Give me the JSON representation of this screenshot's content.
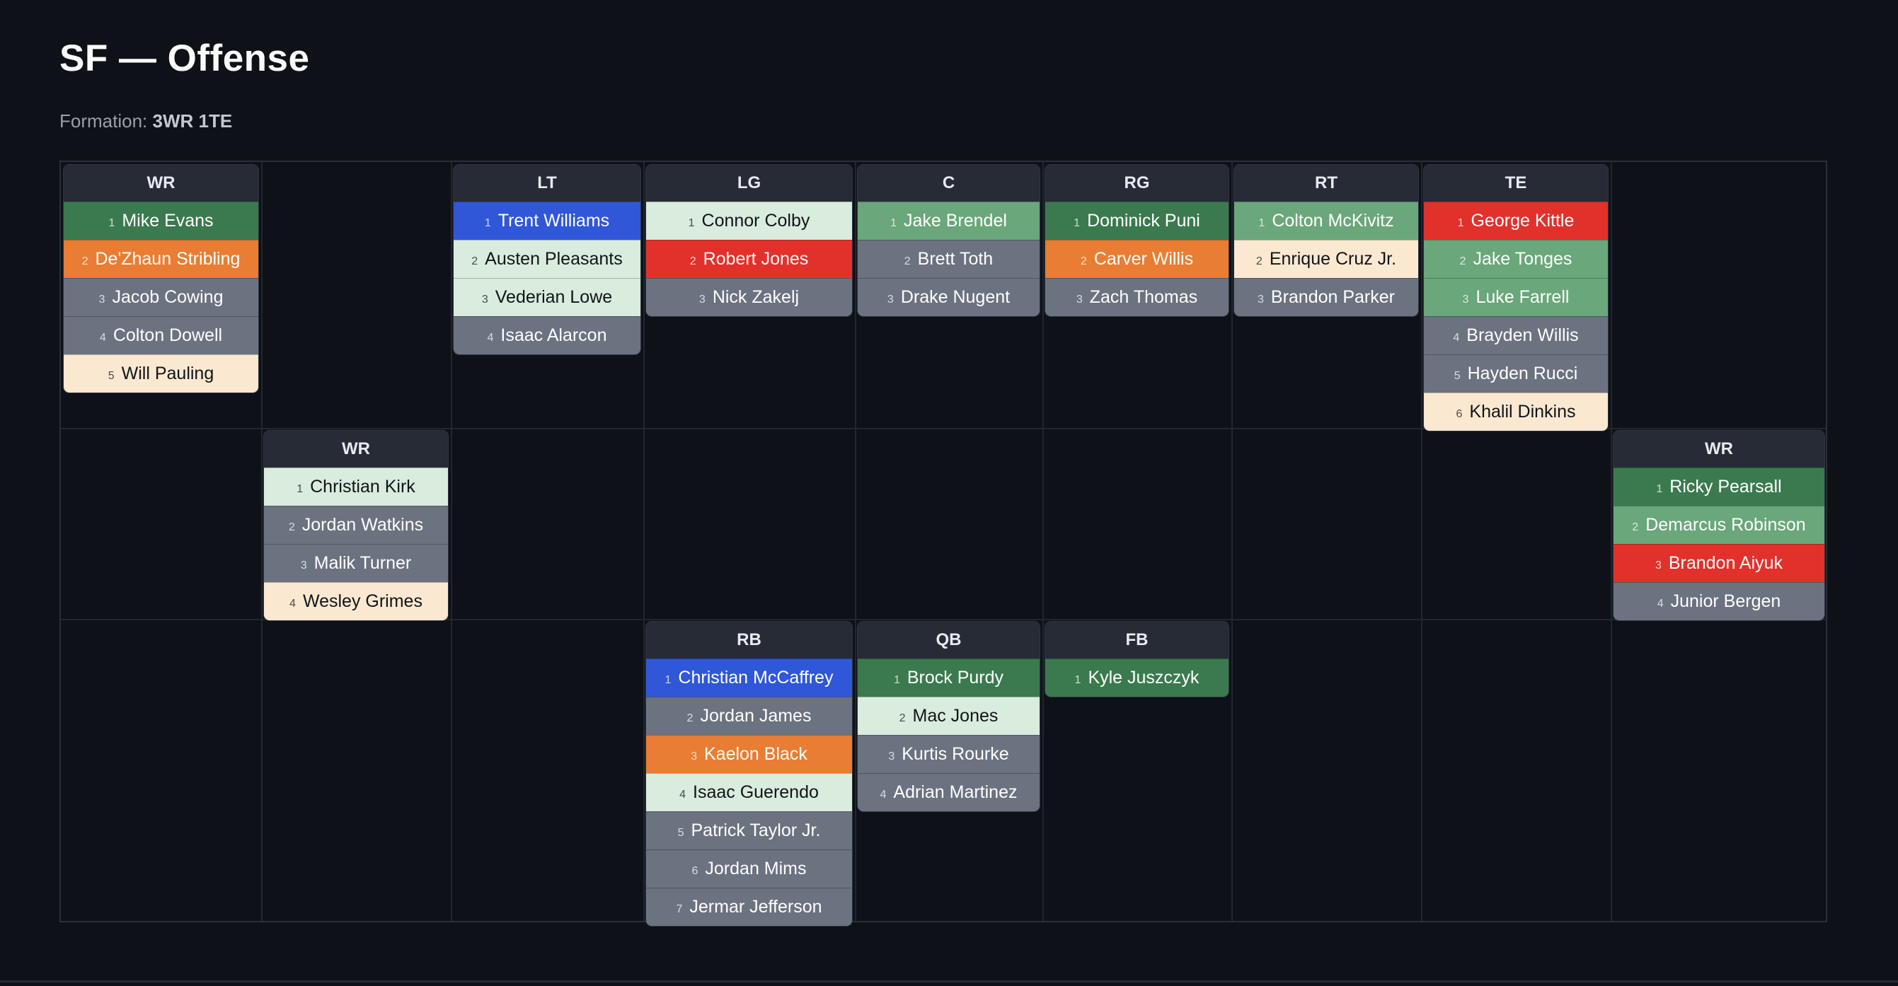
{
  "page": {
    "title": "SF — Offense",
    "formation_label": "Formation:",
    "formation_value": "3WR 1TE"
  },
  "colors": {
    "dark_green": "#3b7a4e",
    "mid_green": "#6aa77a",
    "light_green": "#d9ecdd",
    "orange": "#e97d33",
    "red": "#e2312b",
    "blue": "#2f57d8",
    "gray": "#6b7280",
    "cream": "#fbe8d1"
  },
  "positions": [
    {
      "key": "wr1",
      "label": "WR",
      "players": [
        {
          "n": "1",
          "name": "Mike Evans",
          "color": "dark_green"
        },
        {
          "n": "2",
          "name": "De'Zhaun Stribling",
          "color": "orange"
        },
        {
          "n": "3",
          "name": "Jacob Cowing",
          "color": "gray"
        },
        {
          "n": "4",
          "name": "Colton Dowell",
          "color": "gray"
        },
        {
          "n": "5",
          "name": "Will Pauling",
          "color": "cream"
        }
      ]
    },
    {
      "key": "lt",
      "label": "LT",
      "players": [
        {
          "n": "1",
          "name": "Trent Williams",
          "color": "blue"
        },
        {
          "n": "2",
          "name": "Austen Pleasants",
          "color": "light_green"
        },
        {
          "n": "3",
          "name": "Vederian Lowe",
          "color": "light_green"
        },
        {
          "n": "4",
          "name": "Isaac Alarcon",
          "color": "gray"
        }
      ]
    },
    {
      "key": "lg",
      "label": "LG",
      "players": [
        {
          "n": "1",
          "name": "Connor Colby",
          "color": "light_green"
        },
        {
          "n": "2",
          "name": "Robert Jones",
          "color": "red"
        },
        {
          "n": "3",
          "name": "Nick Zakelj",
          "color": "gray"
        }
      ]
    },
    {
      "key": "c",
      "label": "C",
      "players": [
        {
          "n": "1",
          "name": "Jake Brendel",
          "color": "mid_green"
        },
        {
          "n": "2",
          "name": "Brett Toth",
          "color": "gray"
        },
        {
          "n": "3",
          "name": "Drake Nugent",
          "color": "gray"
        }
      ]
    },
    {
      "key": "rg",
      "label": "RG",
      "players": [
        {
          "n": "1",
          "name": "Dominick Puni",
          "color": "dark_green"
        },
        {
          "n": "2",
          "name": "Carver Willis",
          "color": "orange"
        },
        {
          "n": "3",
          "name": "Zach Thomas",
          "color": "gray"
        }
      ]
    },
    {
      "key": "rt",
      "label": "RT",
      "players": [
        {
          "n": "1",
          "name": "Colton McKivitz",
          "color": "mid_green"
        },
        {
          "n": "2",
          "name": "Enrique Cruz Jr.",
          "color": "cream"
        },
        {
          "n": "3",
          "name": "Brandon Parker",
          "color": "gray"
        }
      ]
    },
    {
      "key": "te",
      "label": "TE",
      "players": [
        {
          "n": "1",
          "name": "George Kittle",
          "color": "red"
        },
        {
          "n": "2",
          "name": "Jake Tonges",
          "color": "mid_green"
        },
        {
          "n": "3",
          "name": "Luke Farrell",
          "color": "mid_green"
        },
        {
          "n": "4",
          "name": "Brayden Willis",
          "color": "gray"
        },
        {
          "n": "5",
          "name": "Hayden Rucci",
          "color": "gray"
        },
        {
          "n": "6",
          "name": "Khalil Dinkins",
          "color": "cream"
        }
      ]
    },
    {
      "key": "wr2",
      "label": "WR",
      "players": [
        {
          "n": "1",
          "name": "Christian Kirk",
          "color": "light_green"
        },
        {
          "n": "2",
          "name": "Jordan Watkins",
          "color": "gray"
        },
        {
          "n": "3",
          "name": "Malik Turner",
          "color": "gray"
        },
        {
          "n": "4",
          "name": "Wesley Grimes",
          "color": "cream"
        }
      ]
    },
    {
      "key": "wr3",
      "label": "WR",
      "players": [
        {
          "n": "1",
          "name": "Ricky Pearsall",
          "color": "dark_green"
        },
        {
          "n": "2",
          "name": "Demarcus Robinson",
          "color": "mid_green"
        },
        {
          "n": "3",
          "name": "Brandon Aiyuk",
          "color": "red"
        },
        {
          "n": "4",
          "name": "Junior Bergen",
          "color": "gray"
        }
      ]
    },
    {
      "key": "rb",
      "label": "RB",
      "players": [
        {
          "n": "1",
          "name": "Christian McCaffrey",
          "color": "blue"
        },
        {
          "n": "2",
          "name": "Jordan James",
          "color": "gray"
        },
        {
          "n": "3",
          "name": "Kaelon Black",
          "color": "orange"
        },
        {
          "n": "4",
          "name": "Isaac Guerendo",
          "color": "light_green"
        },
        {
          "n": "5",
          "name": "Patrick Taylor Jr.",
          "color": "gray"
        },
        {
          "n": "6",
          "name": "Jordan Mims",
          "color": "gray"
        },
        {
          "n": "7",
          "name": "Jermar Jefferson",
          "color": "gray"
        }
      ]
    },
    {
      "key": "qb",
      "label": "QB",
      "players": [
        {
          "n": "1",
          "name": "Brock Purdy",
          "color": "dark_green"
        },
        {
          "n": "2",
          "name": "Mac Jones",
          "color": "light_green"
        },
        {
          "n": "3",
          "name": "Kurtis Rourke",
          "color": "gray"
        },
        {
          "n": "4",
          "name": "Adrian Martinez",
          "color": "gray"
        }
      ]
    },
    {
      "key": "fb",
      "label": "FB",
      "players": [
        {
          "n": "1",
          "name": "Kyle Juszczyk",
          "color": "dark_green"
        }
      ]
    }
  ]
}
